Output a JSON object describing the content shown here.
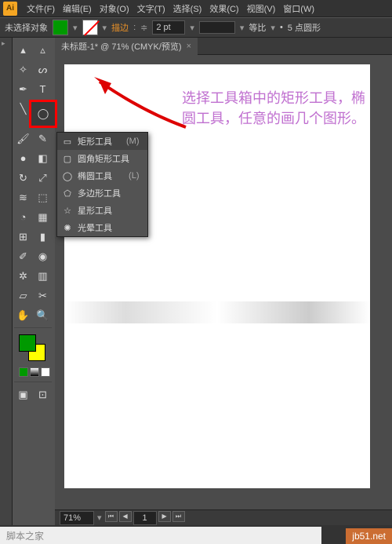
{
  "topbar": {
    "menus": [
      "文件(F)",
      "编辑(E)",
      "对象(O)",
      "文字(T)",
      "选择(S)",
      "效果(C)",
      "视图(V)",
      "窗口(W)"
    ]
  },
  "optbar": {
    "noSelection": "未选择对象",
    "strokeLabel": "描边",
    "strokeWeight": "2 pt",
    "uniformLabel": "等比",
    "pointLabel": "5 点圆形",
    "bullet": "•"
  },
  "doc": {
    "tabTitle": "未标题-1* @ 71% (CMYK/预览)",
    "tabClose": "×"
  },
  "flyout": {
    "items": [
      {
        "icon": "▭",
        "label": "矩形工具",
        "key": "(M)"
      },
      {
        "icon": "▢",
        "label": "圆角矩形工具",
        "key": ""
      },
      {
        "icon": "◯",
        "label": "椭圆工具",
        "key": "(L)"
      },
      {
        "icon": "⬠",
        "label": "多边形工具",
        "key": ""
      },
      {
        "icon": "☆",
        "label": "星形工具",
        "key": ""
      },
      {
        "icon": "✺",
        "label": "光晕工具",
        "key": ""
      }
    ]
  },
  "annotation": {
    "text": "选择工具箱中的矩形工具，椭圆工具，任意的画几个图形。"
  },
  "status": {
    "zoom": "71%",
    "page": "1"
  },
  "watermark": {
    "site": "jb51.net",
    "sub": "脚本之家"
  }
}
